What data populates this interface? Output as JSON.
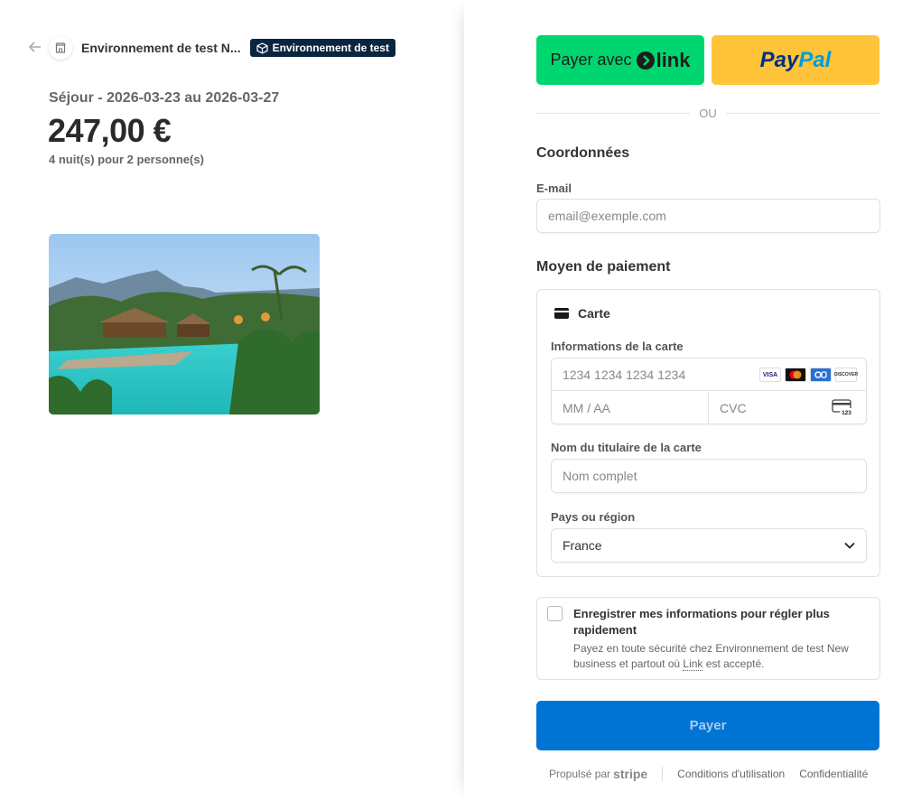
{
  "header": {
    "merchant_name": "Environnement de test N...",
    "test_badge": "Environnement de test"
  },
  "product": {
    "name": "Séjour - 2026-03-23 au 2026-03-27",
    "price": "247,00 €",
    "subtitle": "4 nuit(s) pour 2 personne(s)"
  },
  "express": {
    "link_prefix": "Payer avec",
    "link_word": "link",
    "paypal_part1": "Pay",
    "paypal_part2": "Pal",
    "or_label": "OU"
  },
  "contact": {
    "heading": "Coordonnées",
    "email_label": "E-mail",
    "email_placeholder": "email@exemple.com"
  },
  "payment": {
    "heading": "Moyen de paiement",
    "method_label": "Carte",
    "card_info_label": "Informations de la carte",
    "card_number_placeholder": "1234 1234 1234 1234",
    "expiry_placeholder": "MM / AA",
    "cvc_placeholder": "CVC",
    "cvc_icon_text": "123",
    "brands": [
      "VISA",
      "MC",
      "CB",
      "DISCOVER"
    ],
    "holder_label": "Nom du titulaire de la carte",
    "holder_placeholder": "Nom complet",
    "country_label": "Pays ou région",
    "country_value": "France"
  },
  "save": {
    "title": "Enregistrer mes informations pour régler plus rapidement",
    "description_before": "Payez en toute sécurité chez Environnement de test New business et partout où ",
    "description_link": "Link",
    "description_after": " est accepté."
  },
  "pay_button": "Payer",
  "footer": {
    "powered_by": "Propulsé par",
    "stripe": "stripe",
    "terms": "Conditions d'utilisation",
    "privacy": "Confidentialité"
  },
  "colors": {
    "link_green": "#00d66f",
    "paypal_yellow": "#ffc439",
    "pay_blue": "#0074d4",
    "badge_navy": "#0a2540"
  }
}
